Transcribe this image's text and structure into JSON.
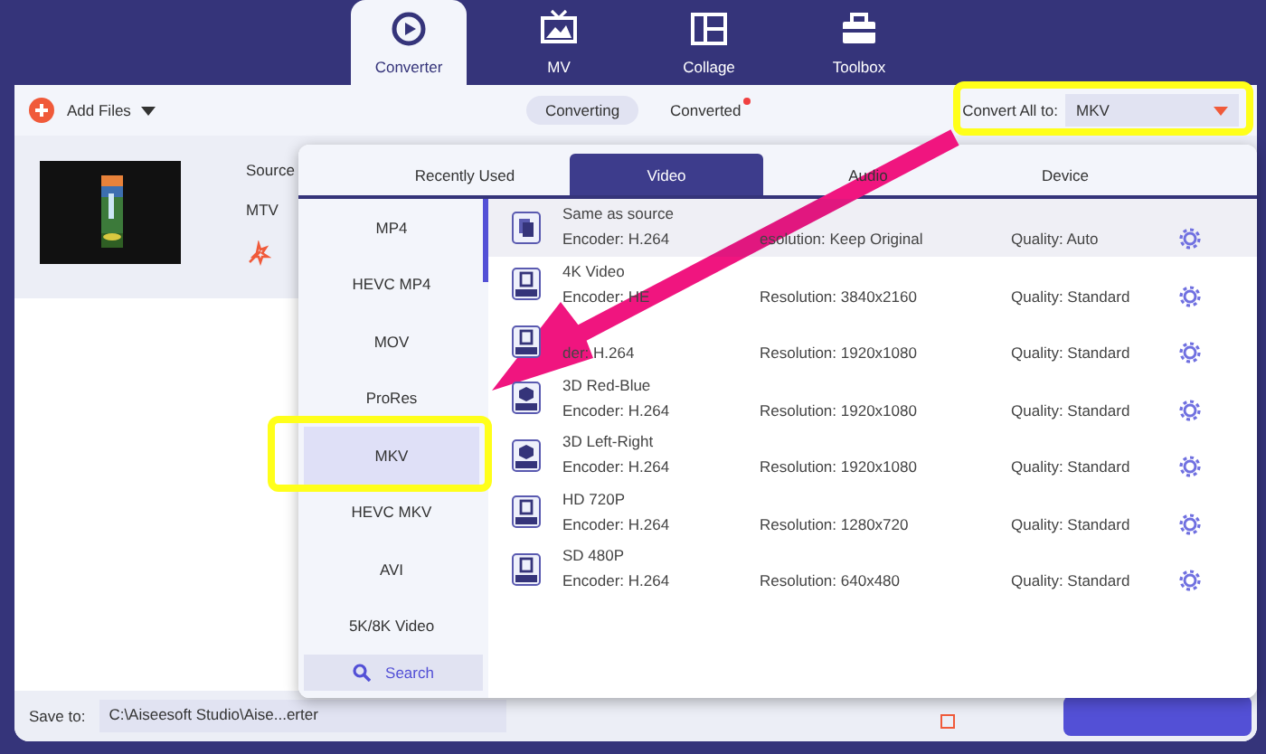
{
  "nav_tabs": [
    {
      "label": "Converter",
      "selected": true
    },
    {
      "label": "MV",
      "selected": false
    },
    {
      "label": "Collage",
      "selected": false
    },
    {
      "label": "Toolbox",
      "selected": false
    }
  ],
  "toolbar": {
    "add_files": "Add Files",
    "views": [
      {
        "label": "Converting",
        "selected": true,
        "dot": false
      },
      {
        "label": "Converted",
        "selected": false,
        "dot": true
      }
    ],
    "convert_all_label": "Convert All to:",
    "convert_all_value": "MKV"
  },
  "file": {
    "source": "Source",
    "format": "MTV"
  },
  "bottom": {
    "save_to_label": "Save to:",
    "save_to_path": "C:\\Aiseesoft Studio\\Aise...erter",
    "merge_checked": false
  },
  "format_dropdown": {
    "tabs": [
      {
        "label": "Recently Used",
        "selected": false
      },
      {
        "label": "Video",
        "selected": true
      },
      {
        "label": "Audio",
        "selected": false
      },
      {
        "label": "Device",
        "selected": false
      }
    ],
    "formats": [
      {
        "label": "MP4",
        "selected": false
      },
      {
        "label": "HEVC MP4",
        "selected": false
      },
      {
        "label": "MOV",
        "selected": false
      },
      {
        "label": "ProRes",
        "selected": false
      },
      {
        "label": "MKV",
        "selected": true
      },
      {
        "label": "HEVC MKV",
        "selected": false
      },
      {
        "label": "AVI",
        "selected": false
      },
      {
        "label": "5K/8K Video",
        "selected": false
      }
    ],
    "search": "Search",
    "presets": [
      {
        "kind": "source",
        "name": "Same as source",
        "encoder": "Encoder: H.264",
        "resolution": "esolution: Keep Original",
        "quality": "Quality: Auto",
        "selected": true
      },
      {
        "kind": "film",
        "name": "4K Video",
        "encoder": "Encoder: HE",
        "resolution": "Resolution: 3840x2160",
        "quality": "Quality: Standard",
        "selected": false
      },
      {
        "kind": "film",
        "encoder": "der: H.264",
        "resolution": "Resolution: 1920x1080",
        "quality": "Quality: Standard",
        "selected": false
      },
      {
        "kind": "cube",
        "name": "3D Red-Blue",
        "encoder": "Encoder: H.264",
        "resolution": "Resolution: 1920x1080",
        "quality": "Quality: Standard",
        "selected": false
      },
      {
        "kind": "cube",
        "name": "3D Left-Right",
        "encoder": "Encoder: H.264",
        "resolution": "Resolution: 1920x1080",
        "quality": "Quality: Standard",
        "selected": false
      },
      {
        "kind": "film",
        "name": "HD 720P",
        "encoder": "Encoder: H.264",
        "resolution": "Resolution: 1280x720",
        "quality": "Quality: Standard",
        "selected": false
      },
      {
        "kind": "film",
        "name": "SD 480P",
        "encoder": "Encoder: H.264",
        "resolution": "Resolution: 640x480",
        "quality": "Quality: Standard",
        "selected": false
      }
    ]
  }
}
